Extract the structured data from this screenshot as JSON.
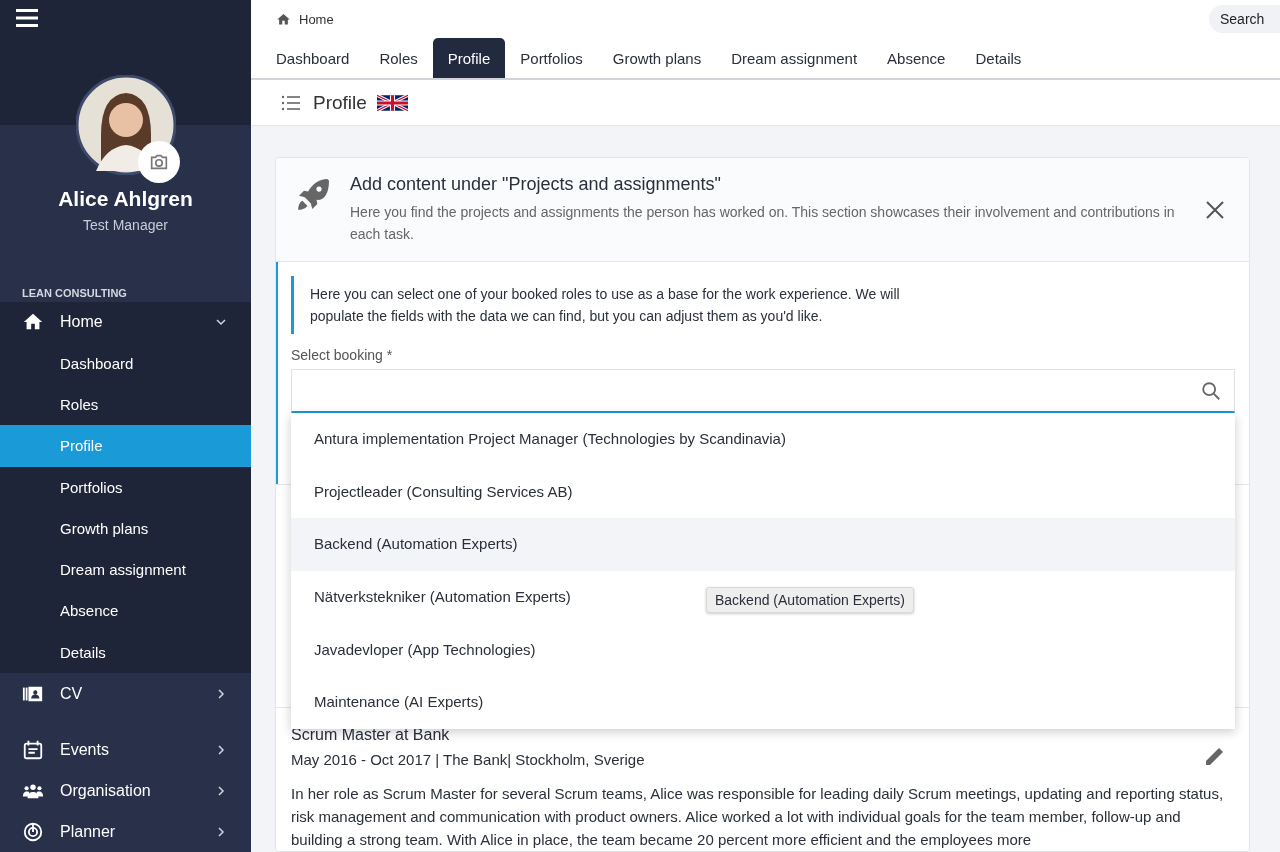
{
  "sidebar": {
    "user": {
      "name": "Alice Ahlgren",
      "role": "Test Manager"
    },
    "section_label": "LEAN CONSULTING",
    "items": [
      {
        "label": "Home",
        "expanded": true,
        "children": [
          {
            "label": "Dashboard",
            "selected": false
          },
          {
            "label": "Roles",
            "selected": false
          },
          {
            "label": "Profile",
            "selected": true
          },
          {
            "label": "Portfolios",
            "selected": false
          },
          {
            "label": "Growth plans",
            "selected": false
          },
          {
            "label": "Dream assignment",
            "selected": false
          },
          {
            "label": "Absence",
            "selected": false
          },
          {
            "label": "Details",
            "selected": false
          }
        ]
      },
      {
        "label": "CV",
        "expanded": false
      },
      {
        "label": "Events",
        "expanded": false
      },
      {
        "label": "Organisation",
        "expanded": false
      },
      {
        "label": "Planner",
        "expanded": false
      }
    ]
  },
  "header": {
    "breadcrumb": "Home",
    "search": {
      "placeholder": "Search"
    },
    "tabs": [
      {
        "label": "Dashboard",
        "selected": false
      },
      {
        "label": "Roles",
        "selected": false
      },
      {
        "label": "Profile",
        "selected": true
      },
      {
        "label": "Portfolios",
        "selected": false
      },
      {
        "label": "Growth plans",
        "selected": false
      },
      {
        "label": "Dream assignment",
        "selected": false
      },
      {
        "label": "Absence",
        "selected": false
      },
      {
        "label": "Details",
        "selected": false
      }
    ]
  },
  "page_title": "Profile",
  "banner": {
    "title": "Add content under \"Projects and assignments\"",
    "text": "Here you find the projects and assignments the person has worked on. This section showcases their involvement and contributions in each task."
  },
  "form": {
    "info": "Here you can select one of your booked roles to use as a base for the work experience. We will populate the fields with the data we can find, but you can adjust them as you'd like.",
    "field": {
      "label": "Select booking *"
    },
    "options": [
      {
        "label": "Antura implementation Project Manager (Technologies by Scandinavia)",
        "selected": false
      },
      {
        "label": "Projectleader (Consulting Services AB)",
        "selected": false
      },
      {
        "label": "Backend (Automation Experts)",
        "selected": true
      },
      {
        "label": "Nätverkstekniker (Automation Experts)",
        "selected": false
      },
      {
        "label": "Javadevloper (App Technologies)",
        "selected": false
      },
      {
        "label": "Maintenance (AI Experts)",
        "selected": false
      }
    ],
    "tooltip": "Backend (Automation Experts)"
  },
  "experience": {
    "title": "Scrum Master at Bank",
    "meta": "May 2016 - Oct 2017 | The Bank| Stockholm, Sverige",
    "description": "In her role as Scrum Master for several Scrum teams, Alice was responsible for leading daily Scrum meetings, updating and reporting status, risk management and communication with product owners. Alice worked a lot with individual goals for the team member, follow-up and building a strong team. With Alice in place, the team became 20 percent more efficient and the employees more"
  }
}
